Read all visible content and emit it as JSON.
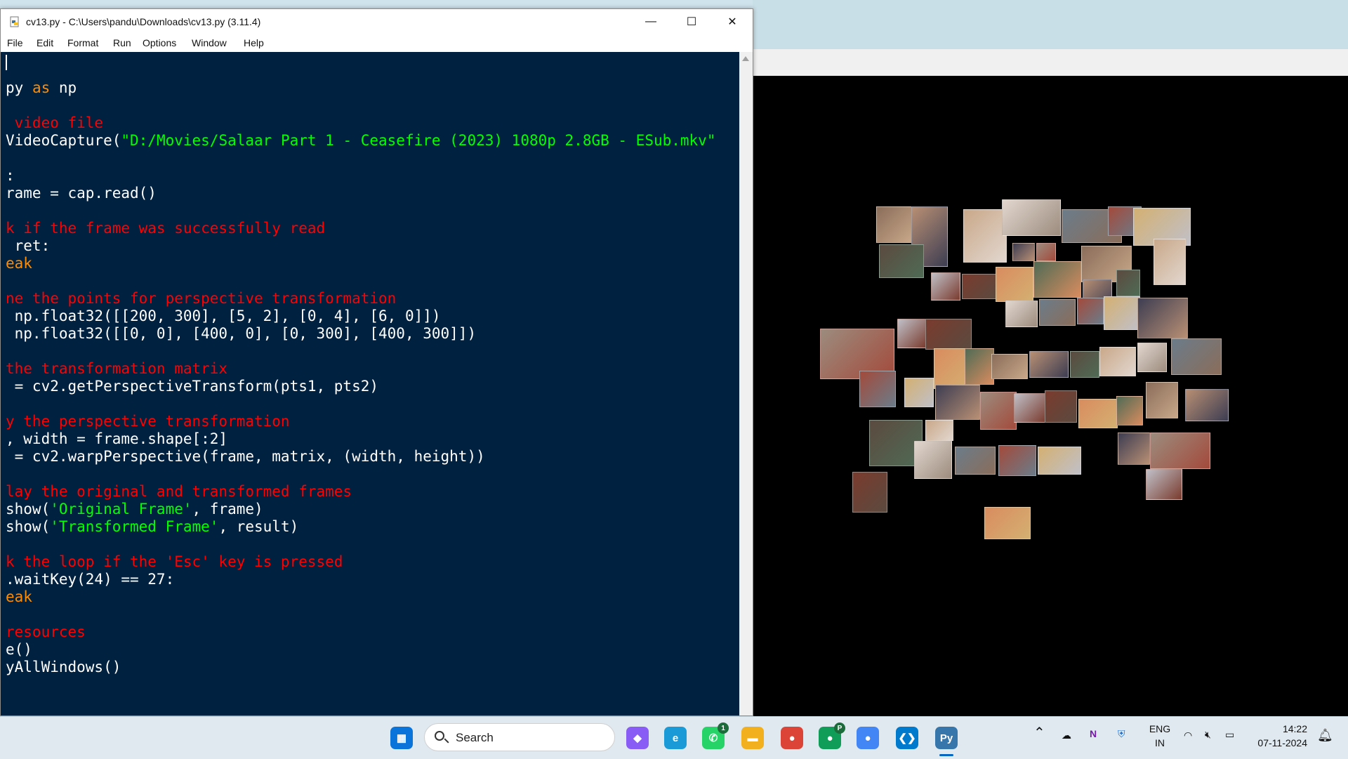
{
  "window": {
    "title": "cv13.py - C:\\Users\\pandu\\Downloads\\cv13.py (3.11.4)",
    "minimize": "—",
    "maximize": "☐",
    "close": "✕"
  },
  "menu": [
    "File",
    "Edit",
    "Format",
    "Run",
    "Options",
    "Window",
    "Help"
  ],
  "code": [
    [],
    [
      {
        "t": "py ",
        "c": "def"
      },
      {
        "t": "as",
        "c": "kw"
      },
      {
        "t": " np",
        "c": "def"
      }
    ],
    [],
    [
      {
        "t": " video file",
        "c": "cm"
      }
    ],
    [
      {
        "t": "VideoCapture(",
        "c": "def"
      },
      {
        "t": "\"D:/Movies/Salaar Part 1 - Ceasefire (2023) 1080p 2.8GB - ESub.mkv\"",
        "c": "st"
      }
    ],
    [],
    [
      {
        "t": ":",
        "c": "def"
      }
    ],
    [
      {
        "t": "rame = cap.read()",
        "c": "def"
      }
    ],
    [],
    [
      {
        "t": "k if the frame was successfully read",
        "c": "cm"
      }
    ],
    [
      {
        "t": " ret:",
        "c": "def"
      }
    ],
    [
      {
        "t": "eak",
        "c": "kw"
      }
    ],
    [],
    [
      {
        "t": "ne the points for perspective transformation",
        "c": "cm"
      }
    ],
    [
      {
        "t": " np.float32([[200, 300], [5, 2], [0, 4], [6, 0]])",
        "c": "def"
      }
    ],
    [
      {
        "t": " np.float32([[0, 0], [400, 0], [0, 300], [400, 300]])",
        "c": "def"
      }
    ],
    [],
    [
      {
        "t": "the transformation matrix",
        "c": "cm"
      }
    ],
    [
      {
        "t": " = cv2.getPerspectiveTransform(pts1, pts2)",
        "c": "def"
      }
    ],
    [],
    [
      {
        "t": "y the perspective transformation",
        "c": "cm"
      }
    ],
    [
      {
        "t": ", width = frame.shape[:2]",
        "c": "def"
      }
    ],
    [
      {
        "t": " = cv2.warpPerspective(frame, matrix, (width, height))",
        "c": "def"
      }
    ],
    [],
    [
      {
        "t": "lay the original and transformed frames",
        "c": "cm"
      }
    ],
    [
      {
        "t": "show(",
        "c": "def"
      },
      {
        "t": "'Original Frame'",
        "c": "st"
      },
      {
        "t": ", frame)",
        "c": "def"
      }
    ],
    [
      {
        "t": "show(",
        "c": "def"
      },
      {
        "t": "'Transformed Frame'",
        "c": "st"
      },
      {
        "t": ", result)",
        "c": "def"
      }
    ],
    [],
    [
      {
        "t": "k the loop if the 'Esc' key is pressed",
        "c": "cm"
      }
    ],
    [
      {
        "t": ".waitKey(24) == 27:",
        "c": "def"
      }
    ],
    [
      {
        "t": "eak",
        "c": "kw"
      }
    ],
    [],
    [
      {
        "t": "resources",
        "c": "cm"
      }
    ],
    [
      {
        "t": "e()",
        "c": "def"
      }
    ],
    [
      {
        "t": "yAllWindows()",
        "c": "def"
      }
    ]
  ],
  "colors": {
    "editor_bg": "#002240",
    "default": "#ffffff",
    "keyword": "#ff8c00",
    "comment": "#ff0000",
    "string": "#00ff00"
  },
  "taskbar": {
    "search_label": "Search",
    "apps": [
      {
        "name": "start-icon",
        "color": "#0a74da",
        "glyph": "▦"
      },
      {
        "name": "copilot-icon",
        "color": "#8a5cf6",
        "glyph": "◆"
      },
      {
        "name": "edge-icon",
        "color": "#1a9bd7",
        "glyph": "e"
      },
      {
        "name": "whatsapp-icon",
        "color": "#25d366",
        "glyph": "✆",
        "badge": "1"
      },
      {
        "name": "file-explorer-icon",
        "color": "#f2b01e",
        "glyph": "▬"
      },
      {
        "name": "chrome-icon",
        "color": "#db4437",
        "glyph": "●"
      },
      {
        "name": "chrome-profile-icon",
        "color": "#0f9d58",
        "glyph": "●",
        "badge": "P"
      },
      {
        "name": "chrome-alt-icon",
        "color": "#4285f4",
        "glyph": "●"
      },
      {
        "name": "vscode-icon",
        "color": "#007acc",
        "glyph": "❮❯"
      },
      {
        "name": "python-idle-icon",
        "color": "#3776ab",
        "glyph": "Py"
      }
    ],
    "tray": {
      "lang_top": "ENG",
      "lang_bottom": "IN",
      "time": "14:22",
      "date": "07-11-2024"
    }
  }
}
